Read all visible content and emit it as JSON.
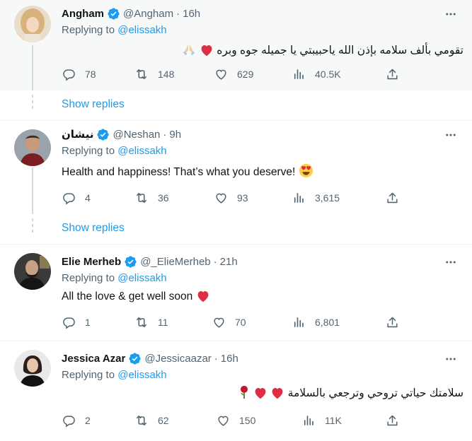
{
  "tweets": [
    {
      "name": "Angham",
      "handle": "@Angham",
      "time": "16h",
      "replying_label": "Replying to",
      "replying_to": "@elissakh",
      "text": "تقومي بألف سلامه بإذن الله ياحبيبتي يا جميله جوه وبره",
      "text_emojis": [
        "red-heart",
        "folded-hands"
      ],
      "replies": "78",
      "retweets": "148",
      "likes": "629",
      "views": "40.5K"
    },
    {
      "name": "نيشان",
      "handle": "@Neshan",
      "time": "9h",
      "replying_label": "Replying to",
      "replying_to": "@elissakh",
      "text": "Health and happiness! That’s what you deserve!",
      "text_emojis": [
        "heart-eyes"
      ],
      "replies": "4",
      "retweets": "36",
      "likes": "93",
      "views": "3,615"
    },
    {
      "name": "Elie Merheb",
      "handle": "@_ElieMerheb",
      "time": "21h",
      "replying_label": "Replying to",
      "replying_to": "@elissakh",
      "text": "All the love & get well soon",
      "text_emojis": [
        "red-heart"
      ],
      "replies": "1",
      "retweets": "11",
      "likes": "70",
      "views": "6,801"
    },
    {
      "name": "Jessica Azar",
      "handle": "@Jessicaazar",
      "time": "16h",
      "replying_label": "Replying to",
      "replying_to": "@elissakh",
      "text": "سلامتك حياتي تروحي وترجعي بالسلامة",
      "text_emojis": [
        "red-heart",
        "red-heart",
        "rose"
      ],
      "replies": "2",
      "retweets": "62",
      "likes": "150",
      "views": "11K"
    }
  ],
  "show_replies": [
    "Show replies",
    "Show replies"
  ],
  "colors": {
    "accent": "#1d9bf0",
    "secondary_text": "#536471",
    "highlight_bg": "#f7f9f9",
    "border": "#eff3f4",
    "heart": "#e0245e"
  },
  "icons": [
    "verified-badge-icon",
    "more-icon",
    "reply-icon",
    "retweet-icon",
    "like-icon",
    "views-icon",
    "share-icon"
  ]
}
